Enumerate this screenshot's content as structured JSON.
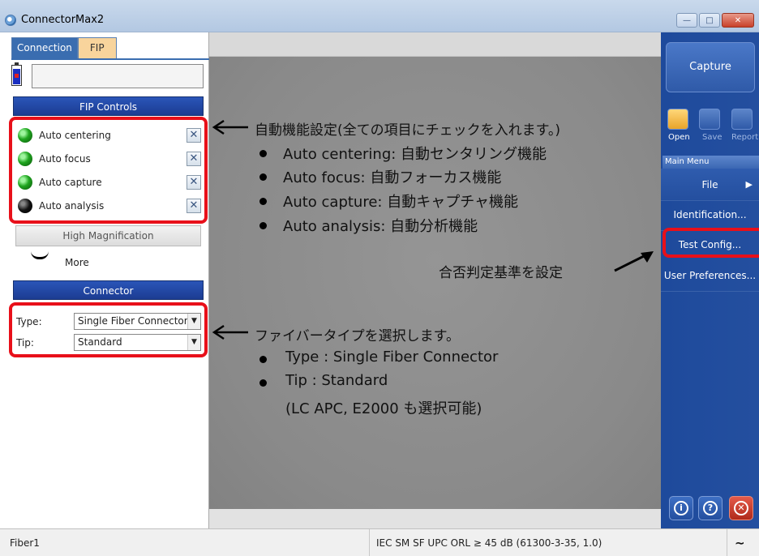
{
  "window": {
    "title": "ConnectorMax2"
  },
  "tabs": [
    {
      "label": "Connection"
    },
    {
      "label": "FIP"
    }
  ],
  "fip_controls": {
    "header": "FIP Controls",
    "items": [
      {
        "label": "Auto centering",
        "led": "green"
      },
      {
        "label": "Auto focus",
        "led": "green"
      },
      {
        "label": "Auto capture",
        "led": "green"
      },
      {
        "label": "Auto analysis",
        "led": "black"
      }
    ],
    "high_mag_label": "High Magnification",
    "more_label": "More"
  },
  "connector": {
    "header": "Connector",
    "type_label": "Type:",
    "type_value": "Single Fiber Connector",
    "tip_label": "Tip:",
    "tip_value": "Standard"
  },
  "right_panel": {
    "capture_label": "Capture",
    "open_label": "Open",
    "save_label": "Save",
    "report_label": "Report",
    "main_menu_label": "Main Menu",
    "menu_items": [
      {
        "label": "File"
      },
      {
        "label": "Identification..."
      },
      {
        "label": "Test Config..."
      },
      {
        "label": "User Preferences..."
      }
    ]
  },
  "status": {
    "left": "Fiber1",
    "middle": "IEC SM SF UPC ORL ≥ 45 dB (61300-3-35, 1.0)"
  },
  "annotations": {
    "auto_title": "自動機能設定(全ての項目にチェックを入れます。)",
    "auto_items": [
      "Auto centering: 自動センタリング機能",
      "Auto focus: 自動フォーカス機能",
      "Auto capture: 自動キャプチャ機能",
      "Auto analysis: 自動分析機能"
    ],
    "criteria": "合否判定基準を設定",
    "fiber_title": "ファイバータイプを選択します。",
    "fiber_items": [
      "Type : Single Fiber Connector",
      "Tip : Standard"
    ],
    "fiber_note": "(LC APC, E2000 も選択可能)"
  },
  "colors": {
    "accent_red": "#e8101a",
    "panel_blue": "#244f9f",
    "header_blue": "#1c3c92"
  }
}
